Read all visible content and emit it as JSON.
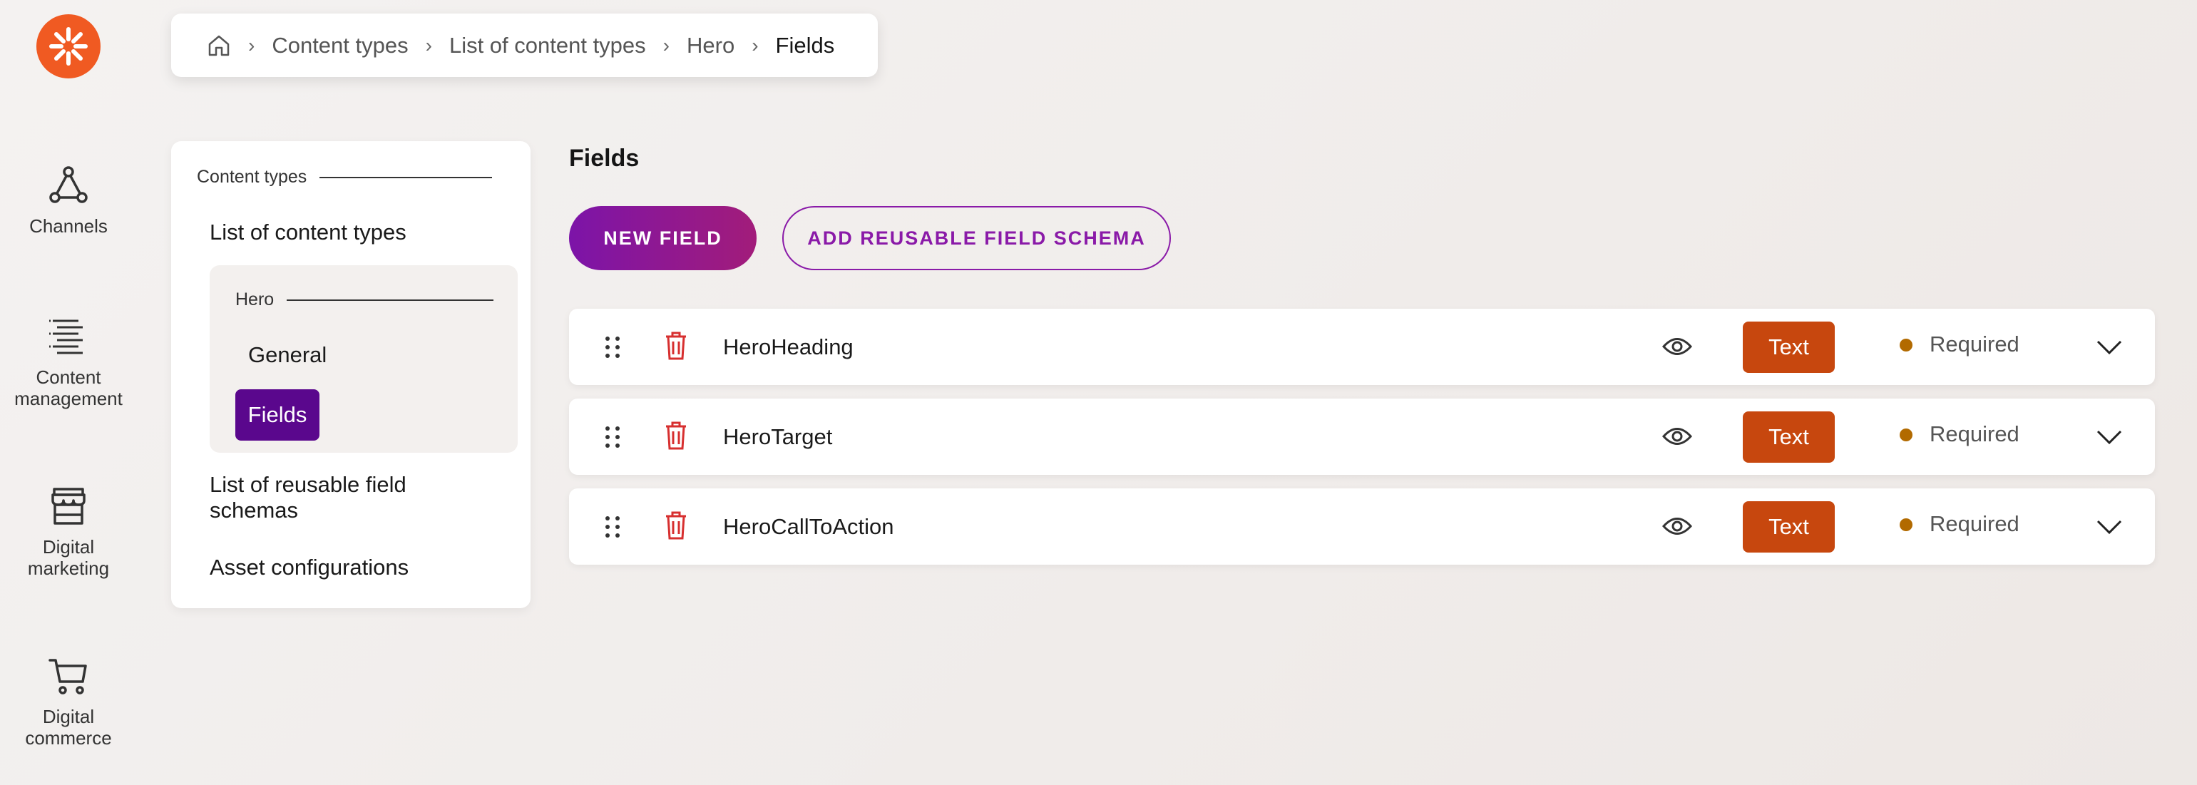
{
  "brand": {
    "logo_icon": "kentico-logo-icon",
    "accent_color": "#f05a22"
  },
  "rail": {
    "items": [
      {
        "label": "Channels",
        "icon": "channels-icon"
      },
      {
        "label": "Content\nmanagement",
        "icon": "content-management-icon"
      },
      {
        "label": "Digital\nmarketing",
        "icon": "storefront-icon"
      },
      {
        "label": "Digital\ncommerce",
        "icon": "shopping-cart-icon"
      }
    ]
  },
  "breadcrumb": {
    "home_icon": "home-icon",
    "items": [
      "Content types",
      "List of content types",
      "Hero",
      "Fields"
    ]
  },
  "panel": {
    "section_title": "Content types",
    "list_link": "List of content types",
    "hero_title": "Hero",
    "general_link": "General",
    "fields_link": "Fields",
    "reusable_link": "List of reusable field schemas",
    "reusable_link_line1": "List of reusable field",
    "reusable_link_line2": "schemas",
    "asset_link": "Asset configurations",
    "active_color": "#5a078d"
  },
  "main": {
    "title": "Fields",
    "new_field_label": "NEW FIELD",
    "add_schema_label": "ADD REUSABLE FIELD SCHEMA",
    "fields": [
      {
        "name": "HeroHeading",
        "type": "Text",
        "status": "Required"
      },
      {
        "name": "HeroTarget",
        "type": "Text",
        "status": "Required"
      },
      {
        "name": "HeroCallToAction",
        "type": "Text",
        "status": "Required"
      }
    ],
    "type_badge_color": "#c7470e",
    "status_dot_color": "#b26a00"
  }
}
